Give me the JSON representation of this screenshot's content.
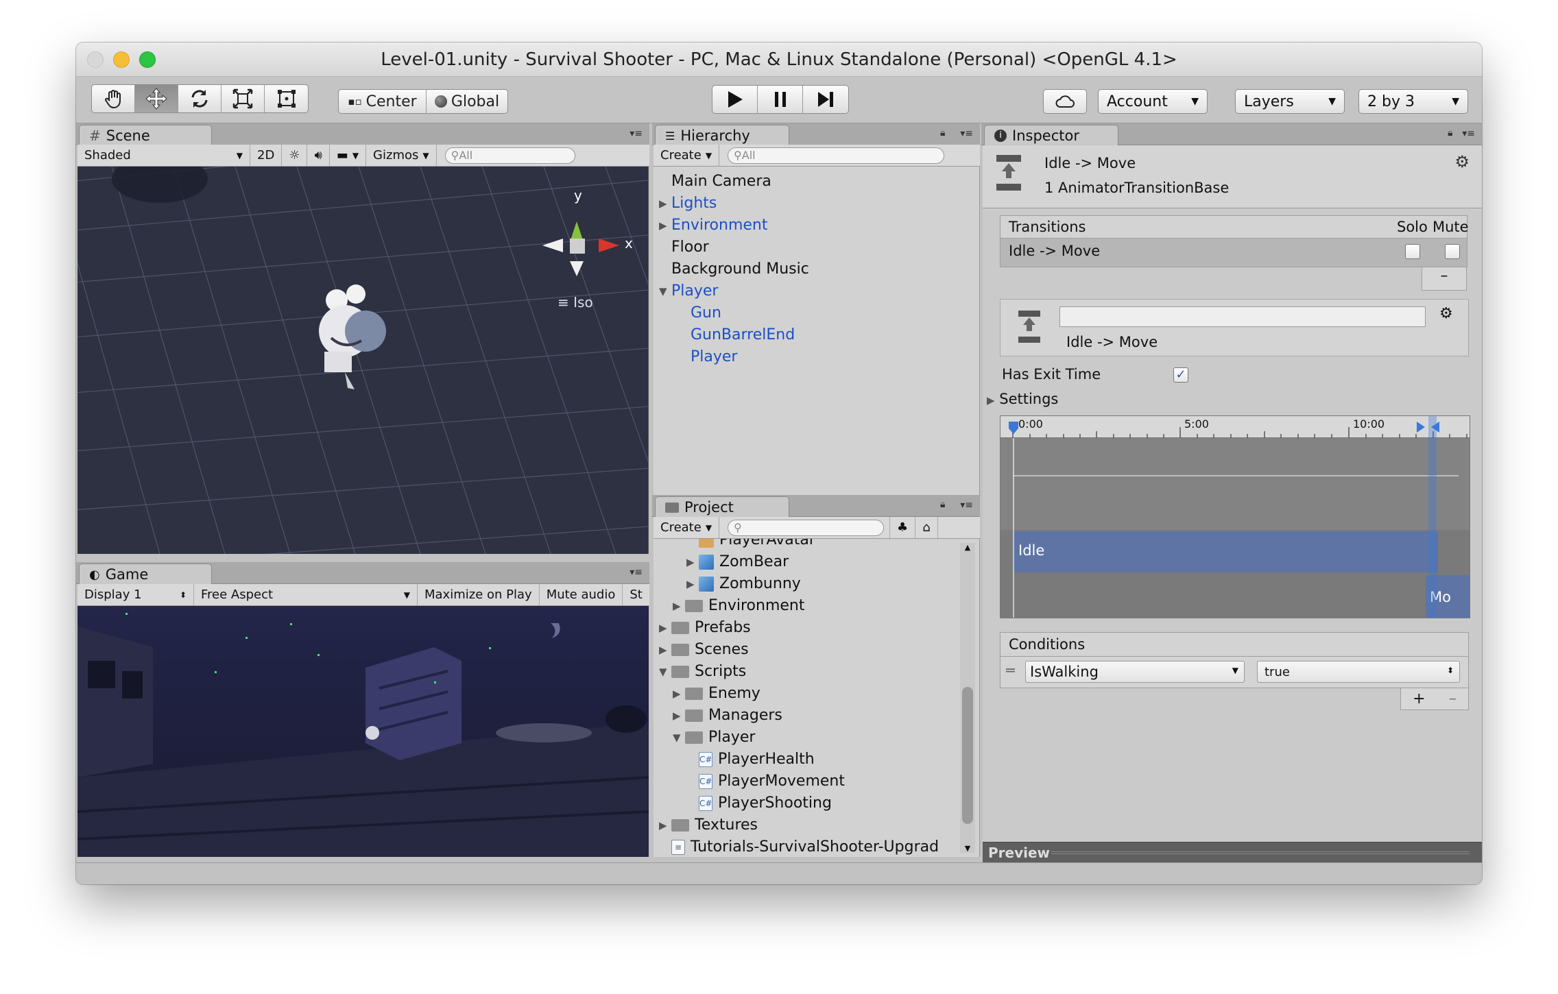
{
  "window": {
    "title": "Level-01.unity - Survival Shooter - PC, Mac & Linux Standalone (Personal) <OpenGL 4.1>"
  },
  "toolbar": {
    "tools": [
      "hand-tool",
      "move-tool",
      "rotate-tool",
      "scale-tool",
      "rect-tool"
    ],
    "pivot_label": "Center",
    "space_label": "Global",
    "account_label": "Account",
    "layers_label": "Layers",
    "layout_label": "2 by 3"
  },
  "scene": {
    "tab_label": "Scene",
    "shading": "Shaded",
    "mode_2d": "2D",
    "gizmos_label": "Gizmos",
    "search_placeholder": "All",
    "axis_y": "y",
    "axis_x": "x",
    "projection": "Iso"
  },
  "game": {
    "tab_label": "Game",
    "display": "Display 1",
    "aspect": "Free Aspect",
    "maximize": "Maximize on Play",
    "mute": "Mute audio",
    "stats": "St"
  },
  "hierarchy": {
    "tab_label": "Hierarchy",
    "create_label": "Create",
    "search_placeholder": "All",
    "items": [
      {
        "label": "Main Camera",
        "expander": "",
        "blue": false,
        "indent": 0
      },
      {
        "label": "Lights",
        "expander": "▶",
        "blue": true,
        "indent": 0
      },
      {
        "label": "Environment",
        "expander": "▶",
        "blue": true,
        "indent": 0
      },
      {
        "label": "Floor",
        "expander": "",
        "blue": false,
        "indent": 0
      },
      {
        "label": "Background Music",
        "expander": "",
        "blue": false,
        "indent": 0
      },
      {
        "label": "Player",
        "expander": "▼",
        "blue": true,
        "indent": 0
      },
      {
        "label": "Gun",
        "expander": "",
        "blue": true,
        "indent": 1
      },
      {
        "label": "GunBarrelEnd",
        "expander": "",
        "blue": true,
        "indent": 1
      },
      {
        "label": "Player",
        "expander": "",
        "blue": true,
        "indent": 1
      }
    ]
  },
  "project": {
    "tab_label": "Project",
    "create_label": "Create",
    "items": [
      {
        "label": "PlayerAvatar",
        "expander": "",
        "icon": "prefab",
        "indent": 2
      },
      {
        "label": "ZomBear",
        "expander": "▶",
        "icon": "model",
        "indent": 2
      },
      {
        "label": "Zombunny",
        "expander": "▶",
        "icon": "model",
        "indent": 2
      },
      {
        "label": "Environment",
        "expander": "▶",
        "icon": "folder",
        "indent": 1
      },
      {
        "label": "Prefabs",
        "expander": "▶",
        "icon": "folder",
        "indent": 0
      },
      {
        "label": "Scenes",
        "expander": "▶",
        "icon": "folder",
        "indent": 0
      },
      {
        "label": "Scripts",
        "expander": "▼",
        "icon": "folder",
        "indent": 0
      },
      {
        "label": "Enemy",
        "expander": "▶",
        "icon": "folder",
        "indent": 1
      },
      {
        "label": "Managers",
        "expander": "▶",
        "icon": "folder",
        "indent": 1
      },
      {
        "label": "Player",
        "expander": "▼",
        "icon": "folder",
        "indent": 1
      },
      {
        "label": "PlayerHealth",
        "expander": "",
        "icon": "script",
        "indent": 2
      },
      {
        "label": "PlayerMovement",
        "expander": "",
        "icon": "script",
        "indent": 2
      },
      {
        "label": "PlayerShooting",
        "expander": "",
        "icon": "script",
        "indent": 2
      },
      {
        "label": "Textures",
        "expander": "▶",
        "icon": "folder",
        "indent": 0
      },
      {
        "label": "Tutorials-SurvivalShooter-Upgrad",
        "expander": "",
        "icon": "file",
        "indent": 0
      }
    ]
  },
  "inspector": {
    "tab_label": "Inspector",
    "object_title": "Idle -> Move",
    "object_subtitle": "1 AnimatorTransitionBase",
    "transitions_header": "Transitions",
    "solo_label": "Solo",
    "mute_label": "Mute",
    "transition_row": "Idle -> Move",
    "minus": "–",
    "transition_name_value": "",
    "transition_title": "Idle -> Move",
    "has_exit_time_label": "Has Exit Time",
    "has_exit_time": true,
    "settings_label": "Settings",
    "timeline": {
      "tick_labels": [
        "0:00",
        "5:00",
        "10:00"
      ],
      "state_from": "Idle",
      "state_to": "Mo"
    },
    "conditions_header": "Conditions",
    "condition_param": "IsWalking",
    "condition_value": "true",
    "plus": "+",
    "preview_label": "Preview"
  },
  "colors": {
    "scene_bg": "#2b2e3d",
    "game_bg": "#1b1d33",
    "selection_blue": "#1b4fc4",
    "timeline_state": "#5e74a4"
  }
}
